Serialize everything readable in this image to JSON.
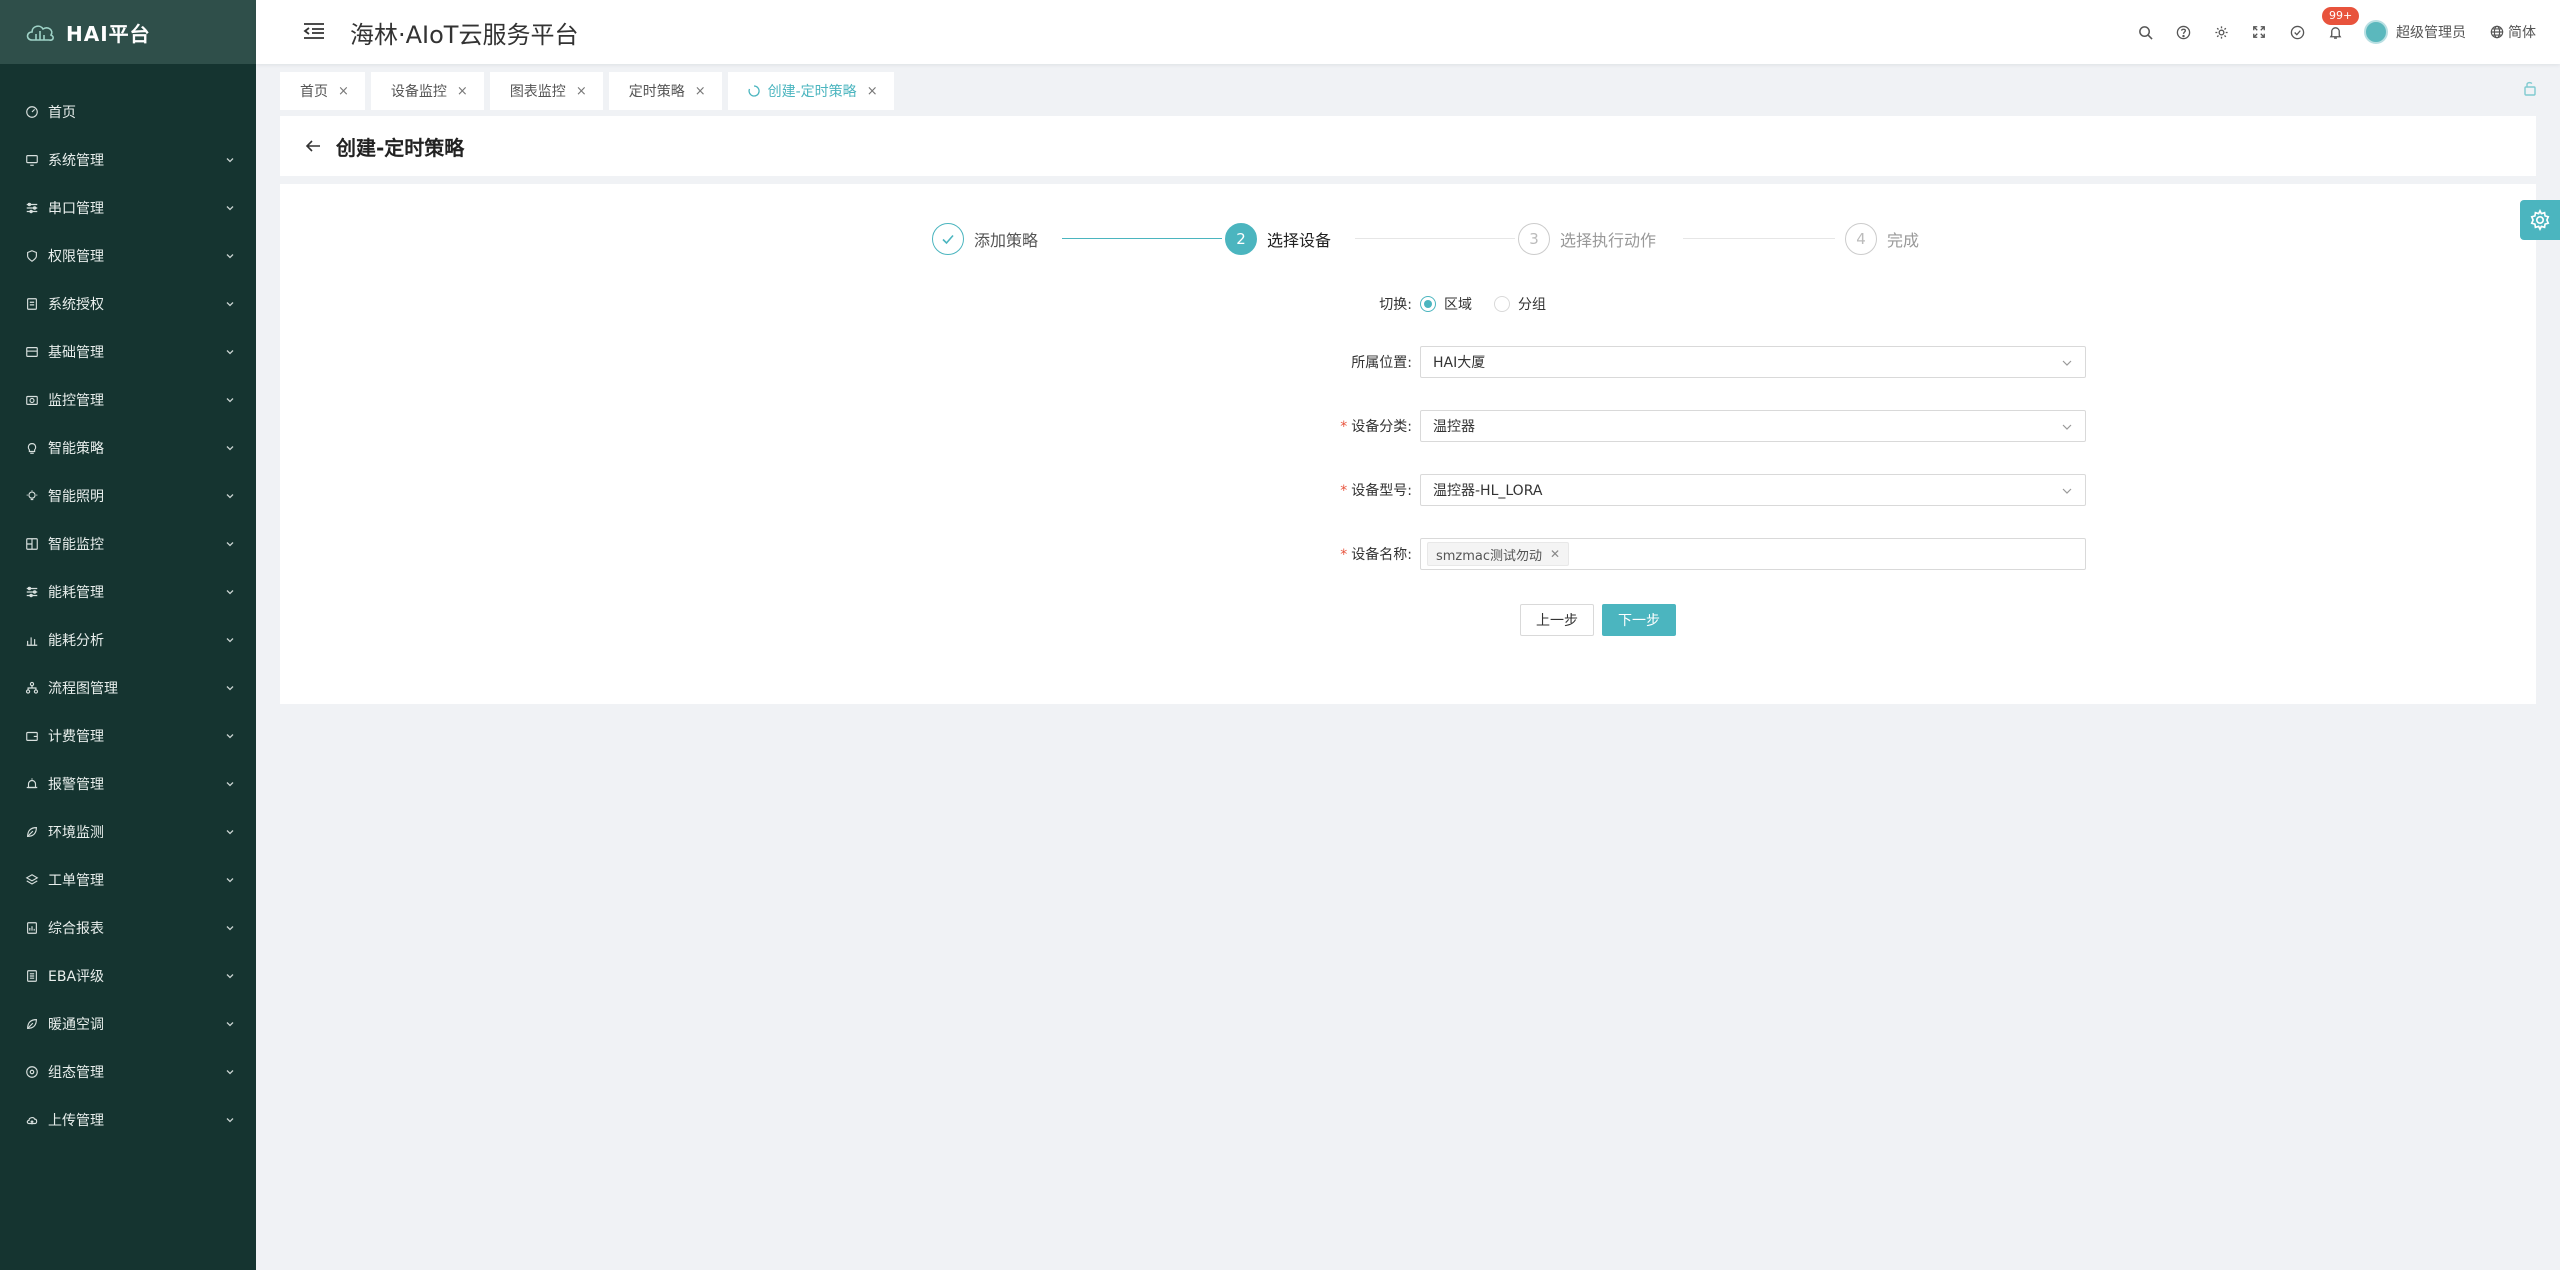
{
  "logo": {
    "text": "HAI平台"
  },
  "header": {
    "app_title": "海林·AIoT云服务平台",
    "notification_badge": "99+",
    "user_name": "超级管理员",
    "language": "简体"
  },
  "sidebar": {
    "items": [
      {
        "label": "首页",
        "icon": "dashboard-icon",
        "has_children": false
      },
      {
        "label": "系统管理",
        "icon": "monitor-icon",
        "has_children": true
      },
      {
        "label": "串口管理",
        "icon": "sliders-icon",
        "has_children": true
      },
      {
        "label": "权限管理",
        "icon": "shield-icon",
        "has_children": true
      },
      {
        "label": "系统授权",
        "icon": "doc-icon",
        "has_children": true
      },
      {
        "label": "基础管理",
        "icon": "box-icon",
        "has_children": true
      },
      {
        "label": "监控管理",
        "icon": "camera-icon",
        "has_children": true
      },
      {
        "label": "智能策略",
        "icon": "bulb-icon",
        "has_children": true
      },
      {
        "label": "智能照明",
        "icon": "light-icon",
        "has_children": true
      },
      {
        "label": "智能监控",
        "icon": "grid-icon",
        "has_children": true
      },
      {
        "label": "能耗管理",
        "icon": "sliders-icon",
        "has_children": true
      },
      {
        "label": "能耗分析",
        "icon": "bar-chart-icon",
        "has_children": true
      },
      {
        "label": "流程图管理",
        "icon": "flow-icon",
        "has_children": true
      },
      {
        "label": "计费管理",
        "icon": "wallet-icon",
        "has_children": true
      },
      {
        "label": "报警管理",
        "icon": "alarm-icon",
        "has_children": true
      },
      {
        "label": "环境监测",
        "icon": "leaf-icon",
        "has_children": true
      },
      {
        "label": "工单管理",
        "icon": "layers-icon",
        "has_children": true
      },
      {
        "label": "综合报表",
        "icon": "report-icon",
        "has_children": true
      },
      {
        "label": "EBA评级",
        "icon": "list-icon",
        "has_children": true
      },
      {
        "label": "暖通空调",
        "icon": "leaf-icon",
        "has_children": true
      },
      {
        "label": "组态管理",
        "icon": "target-icon",
        "has_children": true
      },
      {
        "label": "上传管理",
        "icon": "cloud-upload-icon",
        "has_children": true
      }
    ]
  },
  "tabs": [
    {
      "label": "首页",
      "active": false
    },
    {
      "label": "设备监控",
      "active": false
    },
    {
      "label": "图表监控",
      "active": false
    },
    {
      "label": "定时策略",
      "active": false
    },
    {
      "label": "创建-定时策略",
      "active": true
    }
  ],
  "page": {
    "title": "创建-定时策略"
  },
  "steps": [
    {
      "label": "添加策略",
      "number": "1",
      "status": "done"
    },
    {
      "label": "选择设备",
      "number": "2",
      "status": "current"
    },
    {
      "label": "选择执行动作",
      "number": "3",
      "status": "wait"
    },
    {
      "label": "完成",
      "number": "4",
      "status": "wait"
    }
  ],
  "form": {
    "switch": {
      "label": "切换:",
      "options": [
        "区域",
        "分组"
      ],
      "selected": "区域"
    },
    "location": {
      "label": "所属位置:",
      "value": "HAI大厦"
    },
    "category": {
      "label": "设备分类:",
      "value": "温控器",
      "required": true
    },
    "model": {
      "label": "设备型号:",
      "value": "温控器-HL_LORA",
      "required": true
    },
    "name": {
      "label": "设备名称:",
      "tag": "smzmac测试勿动",
      "required": true
    }
  },
  "buttons": {
    "prev": "上一步",
    "next": "下一步"
  },
  "colors": {
    "primary": "#4bb5bf",
    "sidebar_bg": "#153430",
    "logo_bg": "#2f4f4a",
    "badge": "#e8533c"
  }
}
